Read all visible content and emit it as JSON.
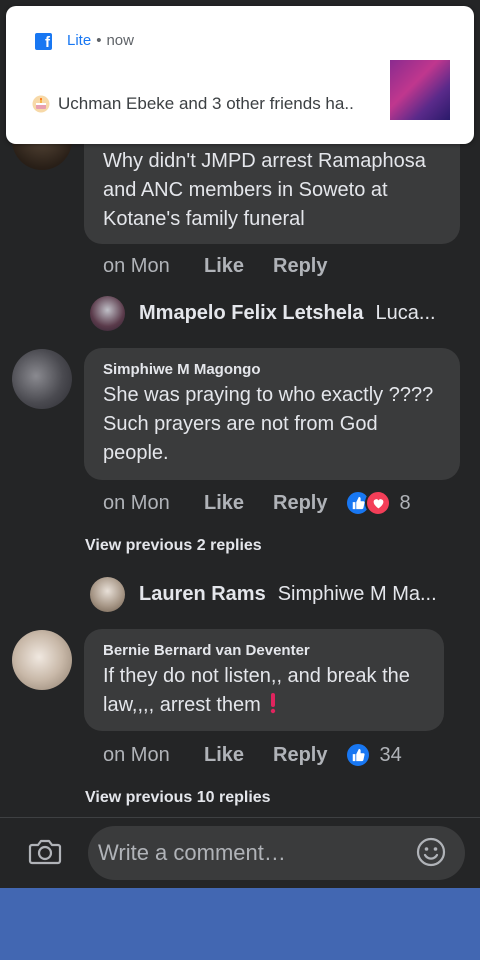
{
  "notification": {
    "app_name": "Lite",
    "separator": "•",
    "time": "now",
    "message": "Uchman Ebeke and 3 other friends ha.."
  },
  "comments": [
    {
      "author": "",
      "text": "Why didn't JMPD arrest Ramaphosa and ANC members in Soweto at Kotane's family funeral",
      "time": "on Mon",
      "like_label": "Like",
      "reply_label": "Reply"
    },
    {
      "author": "Simphiwe M Magongo",
      "text": "She was praying to who exactly ???? Such prayers are not from God people.",
      "time": "on Mon",
      "like_label": "Like",
      "reply_label": "Reply",
      "reaction_count": "8"
    },
    {
      "author": "Bernie Bernard van Deventer",
      "text": "If they do not listen,, and break the law,,,, arrest them",
      "time": "on Mon",
      "like_label": "Like",
      "reply_label": "Reply",
      "reaction_count": "34"
    }
  ],
  "reply_previews": [
    {
      "name": "Mmapelo Felix Letshela",
      "text": "Luca..."
    },
    {
      "name": "Lauren Rams",
      "text": "Simphiwe M Ma..."
    }
  ],
  "view_previous": [
    "View previous 2 replies",
    "View previous 10 replies"
  ],
  "composer": {
    "placeholder": "Write a comment…"
  },
  "colors": {
    "background": "#242526",
    "bubble": "#3a3b3c",
    "facebook_blue": "#1877f2",
    "bottom_bar": "#4267b2",
    "love_red": "#f33e58"
  },
  "icons": [
    "facebook-icon",
    "cake-icon",
    "like-reaction-icon",
    "love-reaction-icon",
    "exclamation-icon",
    "camera-icon",
    "emoji-icon"
  ]
}
